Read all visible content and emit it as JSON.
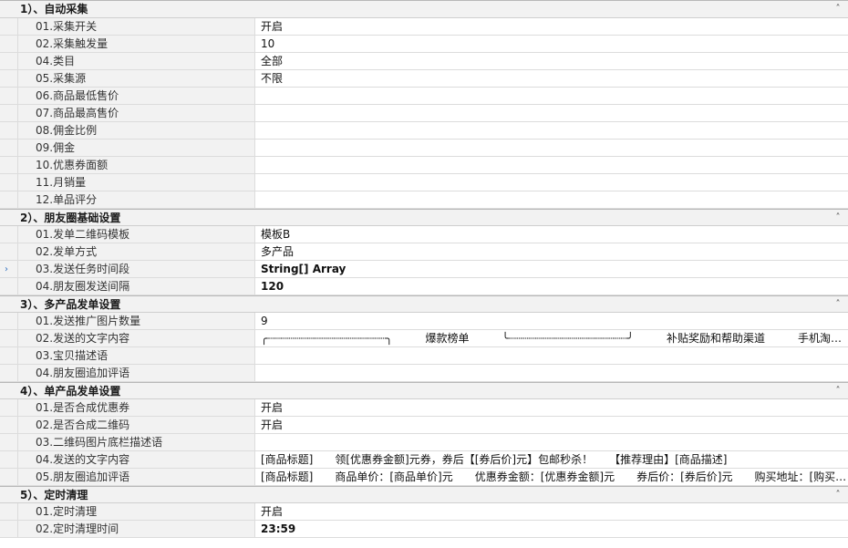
{
  "sections": [
    {
      "title": "1）、自动采集",
      "rows": [
        {
          "label": "01.采集开关",
          "value": "开启"
        },
        {
          "label": "02.采集触发量",
          "value": "10"
        },
        {
          "label": "04.类目",
          "value": "全部"
        },
        {
          "label": "05.采集源",
          "value": "不限"
        },
        {
          "label": "06.商品最低售价",
          "value": ""
        },
        {
          "label": "07.商品最高售价",
          "value": ""
        },
        {
          "label": "08.佣金比例",
          "value": ""
        },
        {
          "label": "09.佣金",
          "value": ""
        },
        {
          "label": "10.优惠券面额",
          "value": ""
        },
        {
          "label": "11.月销量",
          "value": ""
        },
        {
          "label": "12.单品评分",
          "value": ""
        }
      ]
    },
    {
      "title": "2）、朋友圈基础设置",
      "rows": [
        {
          "label": "01.发单二维码模板",
          "value": "模板B"
        },
        {
          "label": "02.发单方式",
          "value": "多产品"
        },
        {
          "label": "03.发送任务时间段",
          "value": "String[] Array",
          "bold": true,
          "selected": true
        },
        {
          "label": "04.朋友圈发送间隔",
          "value": "120",
          "bold": true
        }
      ]
    },
    {
      "title": "3）、多产品发单设置",
      "rows": [
        {
          "label": "01.发送推广图片数量",
          "value": "9"
        },
        {
          "label": "02.发送的文字内容",
          "value": "╭┈┈┈┈┈┈┈┈┈┈┈┈┈┈┈┈┈┈╮　　　爆款榜单　　　╰┈┈┈┈┈┈┈┈┈┈┈┈┈┈┈┈┈┈╯　　　补贴奖励和帮助渠道　　　手机淘宝分享宝贝链接给我"
        },
        {
          "label": "03.宝贝描述语",
          "value": ""
        },
        {
          "label": "04.朋友圈追加评语",
          "value": ""
        }
      ]
    },
    {
      "title": "4）、单产品发单设置",
      "rows": [
        {
          "label": "01.是否合成优惠券",
          "value": "开启"
        },
        {
          "label": "02.是否合成二维码",
          "value": "开启"
        },
        {
          "label": "03.二维码图片底栏描述语",
          "value": ""
        },
        {
          "label": "04.发送的文字内容",
          "value": "[商品标题]　　领[优惠券金额]元券，券后【[券后价]元】包邮秒杀！　　【推荐理由】[商品描述]"
        },
        {
          "label": "05.朋友圈追加评语",
          "value": "[商品标题]　　商品单价：[商品单价]元　　优惠券金额：[优惠券金额]元　　券后价：[券后价]元　　购买地址：[购买地址]"
        }
      ]
    },
    {
      "title": "5）、定时清理",
      "rows": [
        {
          "label": "01.定时清理",
          "value": "开启"
        },
        {
          "label": "02.定时清理时间",
          "value": "23:59",
          "bold": true
        }
      ]
    }
  ],
  "icons": {
    "collapse": "chevron-up-icon",
    "selected_row": "caret-right-icon"
  }
}
